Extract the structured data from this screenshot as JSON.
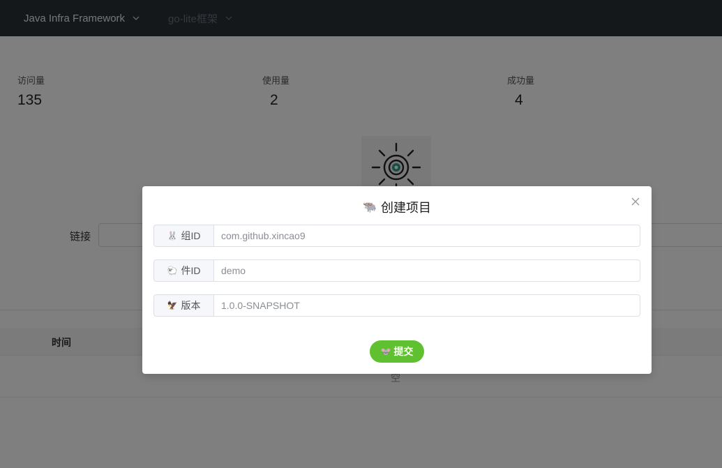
{
  "nav": {
    "items": [
      {
        "label": "Java Infra Framework"
      },
      {
        "label": "go-lite框架"
      }
    ]
  },
  "stats": [
    {
      "label": "访问量",
      "value": "135"
    },
    {
      "label": "使用量",
      "value": "2"
    },
    {
      "label": "成功量",
      "value": "4"
    }
  ],
  "link": {
    "label": "链接"
  },
  "table": {
    "column_time": "时间",
    "empty_text": "空"
  },
  "modal": {
    "title": "创建项目",
    "title_icon": "🐃",
    "fields": [
      {
        "label": "组ID",
        "icon": "🐰",
        "placeholder": "com.github.xincao9"
      },
      {
        "label": "件ID",
        "icon": "🐑",
        "placeholder": "demo"
      },
      {
        "label": "版本",
        "icon": "🦅",
        "placeholder": "1.0.0-SNAPSHOT"
      }
    ],
    "submit": {
      "label": "提交",
      "icon": "🐭"
    }
  },
  "colors": {
    "topbar": "#2b3036",
    "submit_button": "#5fc130",
    "overlay": "rgba(0,0,0,0.5)"
  }
}
